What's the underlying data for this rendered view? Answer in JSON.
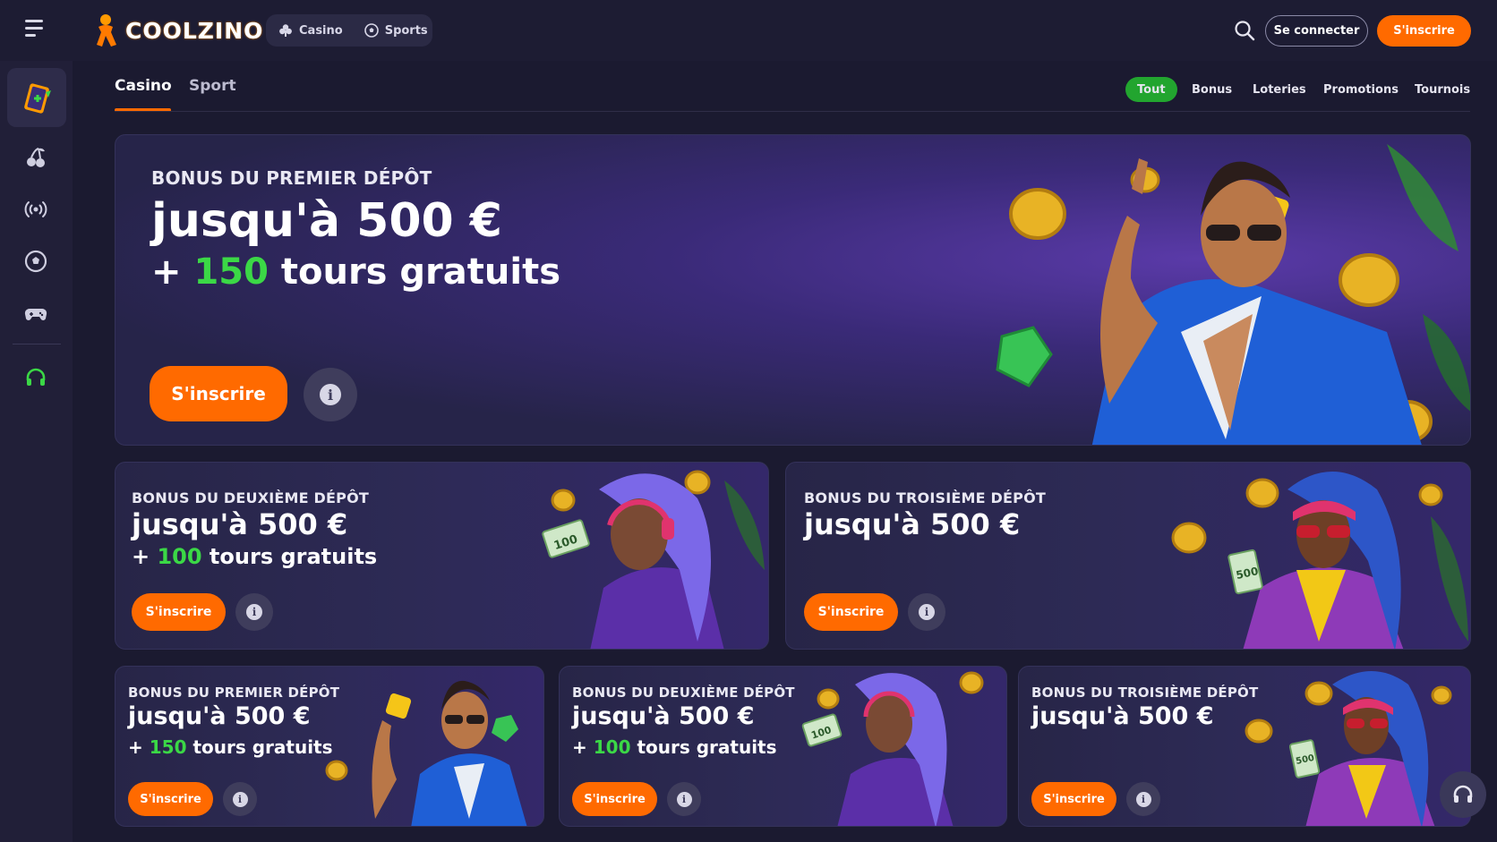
{
  "header": {
    "logo_text": "COOLZINO",
    "modes": [
      {
        "label": "Casino",
        "icon": "club-icon"
      },
      {
        "label": "Sports",
        "icon": "soccer-ball-icon"
      }
    ],
    "login_label": "Se connecter",
    "signup_label": "S'inscrire"
  },
  "sidebar": {
    "items": [
      {
        "name": "promo-card-icon",
        "active": true
      },
      {
        "name": "cherries-icon"
      },
      {
        "name": "live-broadcast-icon"
      },
      {
        "name": "soccer-ball-icon"
      },
      {
        "name": "gamepad-icon"
      },
      {
        "name": "headset-icon"
      }
    ]
  },
  "subnav": {
    "tabs": [
      "Casino",
      "Sport"
    ],
    "filters": [
      "Tout",
      "Bonus",
      "Loteries",
      "Promotions",
      "Tournois"
    ],
    "active_filter": "Tout"
  },
  "hero": {
    "kicker": "BONUS DU PREMIER DÉPÔT",
    "amount": "jusqu'à 500 €",
    "spins_prefix": "+ ",
    "spins_number": "150",
    "spins_suffix": " tours gratuits",
    "signup_label": "S'inscrire"
  },
  "row2": [
    {
      "kicker": "BONUS DU DEUXIÈME DÉPÔT",
      "amount": "jusqu'à 500 €",
      "spins_prefix": "+ ",
      "spins_number": "100",
      "spins_suffix": " tours gratuits",
      "signup_label": "S'inscrire"
    },
    {
      "kicker": "BONUS DU TROISIÈME DÉPÔT",
      "amount": "jusqu'à 500 €",
      "signup_label": "S'inscrire"
    }
  ],
  "row3": [
    {
      "kicker": "BONUS DU PREMIER DÉPÔT",
      "amount": "jusqu'à 500 €",
      "spins_prefix": "+ ",
      "spins_number": "150",
      "spins_suffix": " tours gratuits",
      "signup_label": "S'inscrire"
    },
    {
      "kicker": "BONUS DU DEUXIÈME DÉPÔT",
      "amount": "jusqu'à 500 €",
      "spins_prefix": "+ ",
      "spins_number": "100",
      "spins_suffix": " tours gratuits",
      "signup_label": "S'inscrire"
    },
    {
      "kicker": "BONUS DU TROISIÈME DÉPÔT",
      "amount": "jusqu'à 500 €",
      "signup_label": "S'inscrire"
    }
  ],
  "colors": {
    "accent": "#ff6a00",
    "green": "#3bd846",
    "active_filter": "#22a52f",
    "background": "#1b1a30"
  },
  "banknotes": [
    "100",
    "500"
  ]
}
